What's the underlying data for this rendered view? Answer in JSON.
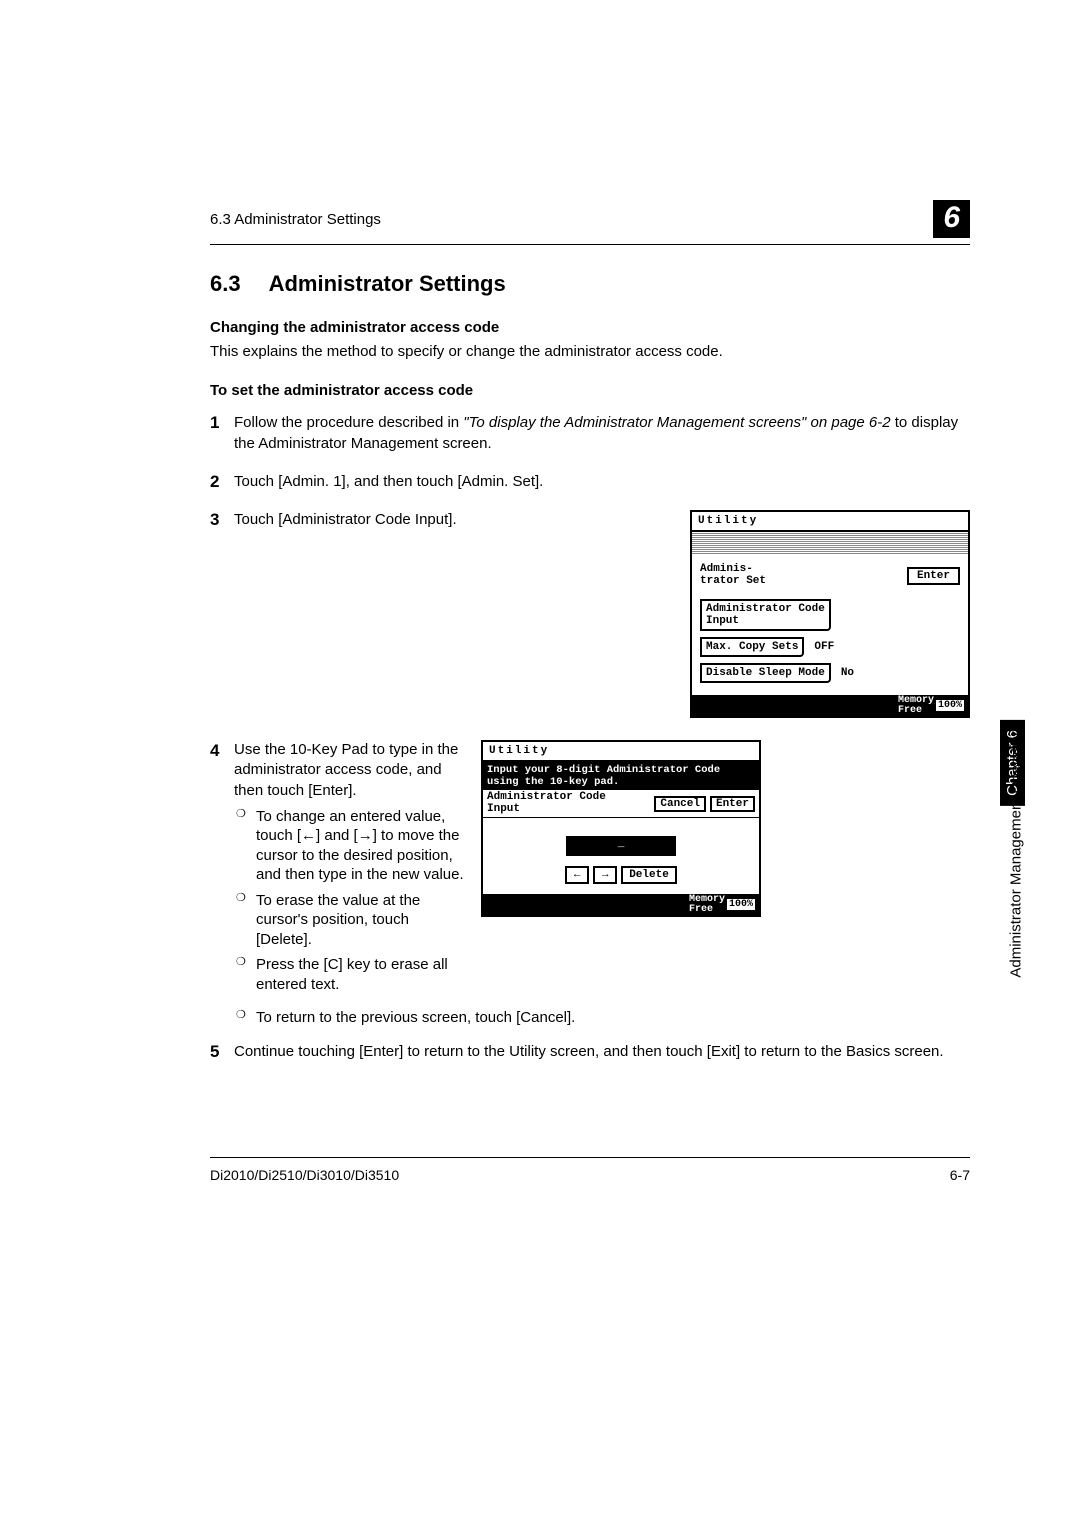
{
  "header": {
    "left": "6.3 Administrator Settings",
    "chapter_badge": "6"
  },
  "title": {
    "num": "6.3",
    "text": "Administrator Settings"
  },
  "sub1": "Changing the administrator access code",
  "intro": "This explains the method to specify or change the administrator access code.",
  "sub2": "To set the administrator access code",
  "steps": {
    "s1": {
      "num": "1",
      "pre": "Follow the procedure described in ",
      "ref": "\"To display the Administrator Management screens\" on page 6-2",
      "post": " to display the Administrator Management screen."
    },
    "s2": {
      "num": "2",
      "text": "Touch [Admin. 1], and then touch [Admin. Set]."
    },
    "s3": {
      "num": "3",
      "text": "Touch [Administrator Code Input]."
    },
    "s4": {
      "num": "4",
      "text": "Use the 10-Key Pad to type in the administrator access code, and then touch [Enter].",
      "b1": "To change an entered value, touch [←] and [→] to move the cursor to the desired position, and then type in the new value.",
      "b2": "To erase the value at the cursor's position, touch [Delete].",
      "b3": "Press the [C] key to erase all entered text.",
      "b4": "To return to the previous screen, touch [Cancel]."
    },
    "s5": {
      "num": "5",
      "text": "Continue touching [Enter] to return to the Utility screen, and then touch [Exit] to return to the Basics screen."
    }
  },
  "screen1": {
    "title": "Utility",
    "adminset_l1": "Adminis-",
    "adminset_l2": "trator Set",
    "enter": "Enter",
    "btn1_l1": "Administrator Code",
    "btn1_l2": "Input",
    "btn2": "Max. Copy Sets",
    "btn2_val": "OFF",
    "btn3": "Disable Sleep Mode",
    "btn3_val": "No",
    "mem1": "Memory",
    "mem2": "Free",
    "pct": "100%"
  },
  "screen2": {
    "title": "Utility",
    "instr": "Input your 8-digit Administrator Code using the 10-key pad.",
    "lbl_l1": "Administrator Code",
    "lbl_l2": "Input",
    "cancel": "Cancel",
    "enter": "Enter",
    "cursor": "_",
    "left": "←",
    "right": "→",
    "delete": "Delete",
    "mem1": "Memory",
    "mem2": "Free",
    "pct": "100%"
  },
  "footer": {
    "left": "Di2010/Di2510/Di3010/Di3510",
    "right": "6-7"
  },
  "side": {
    "label": "Administrator Management Operations",
    "chapter": "Chapter 6"
  }
}
